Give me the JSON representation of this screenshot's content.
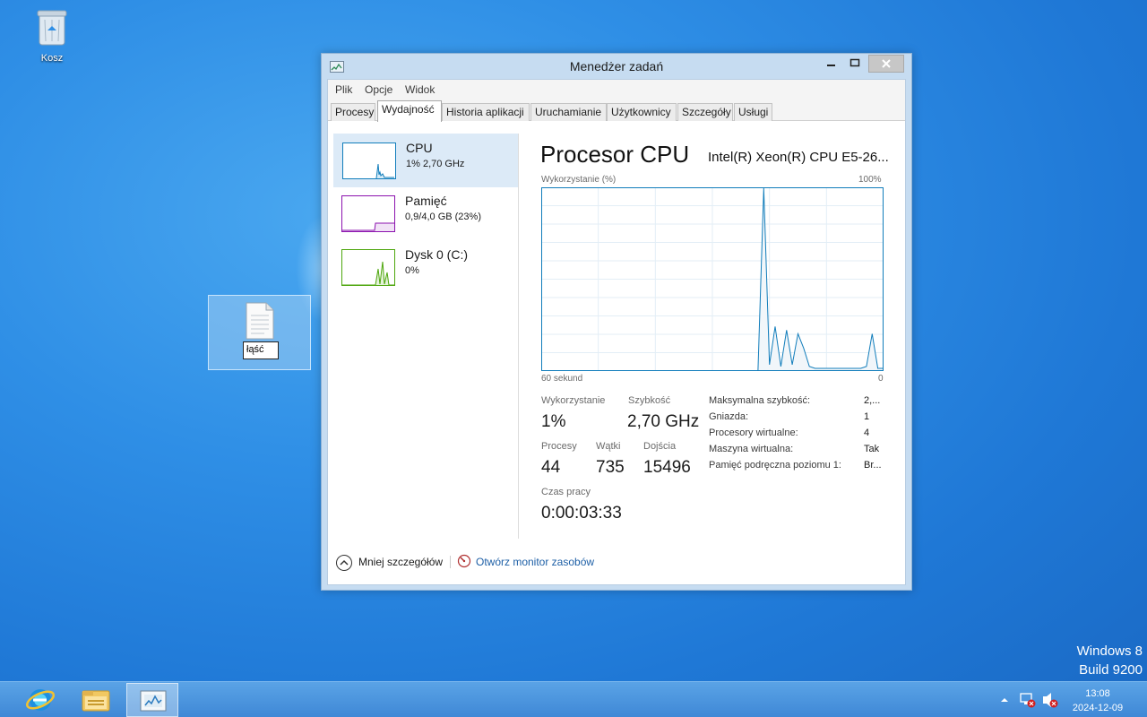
{
  "desktop": {
    "recycle_bin_label": "Kosz",
    "rename_value": "łąść"
  },
  "window": {
    "title": "Menedżer zadań",
    "menu": [
      "Plik",
      "Opcje",
      "Widok"
    ],
    "tabs": [
      "Procesy",
      "Wydajność",
      "Historia aplikacji",
      "Uruchamianie",
      "Użytkownicy",
      "Szczegóły",
      "Usługi"
    ],
    "active_tab": "Wydajność"
  },
  "perf_list": [
    {
      "name": "CPU",
      "detail": "1%  2,70 GHz",
      "color": "#117dbb"
    },
    {
      "name": "Pamięć",
      "detail": "0,9/4,0 GB (23%)",
      "color": "#8b12ae"
    },
    {
      "name": "Dysk 0 (C:)",
      "detail": "0%",
      "color": "#4da60c"
    }
  ],
  "cpu_panel": {
    "title": "Procesor CPU",
    "model": "Intel(R) Xeon(R) CPU E5-26...",
    "graph_label_left": "Wykorzystanie (%)",
    "graph_label_right": "100%",
    "x_label_left": "60 sekund",
    "x_label_right": "0",
    "utilization_label": "Wykorzystanie",
    "utilization_value": "1%",
    "speed_label": "Szybkość",
    "speed_value": "2,70 GHz",
    "processes_label": "Procesy",
    "processes_value": "44",
    "threads_label": "Wątki",
    "threads_value": "735",
    "handles_label": "Dojścia",
    "handles_value": "15496",
    "uptime_label": "Czas pracy",
    "uptime_value": "0:00:03:33",
    "specs": [
      {
        "label": "Maksymalna szybkość:",
        "value": "2,..."
      },
      {
        "label": "Gniazda:",
        "value": "1"
      },
      {
        "label": "Procesory wirtualne:",
        "value": "4"
      },
      {
        "label": "Maszyna wirtualna:",
        "value": "Tak"
      },
      {
        "label": "Pamięć podręczna poziomu 1:",
        "value": "Br..."
      }
    ]
  },
  "chart_data": {
    "type": "line",
    "ylabel": "Wykorzystanie (%)",
    "ylim": [
      0,
      100
    ],
    "xlim": [
      60,
      0
    ],
    "x": [
      60,
      59,
      58,
      57,
      56,
      55,
      54,
      53,
      52,
      51,
      50,
      49,
      48,
      47,
      46,
      45,
      44,
      43,
      42,
      41,
      40,
      39,
      38,
      37,
      36,
      35,
      34,
      33,
      32,
      31,
      30,
      29,
      28,
      27,
      26,
      25,
      24,
      23,
      22,
      21,
      20,
      19,
      18,
      17,
      16,
      15,
      14,
      13,
      12,
      11,
      10,
      9,
      8,
      7,
      6,
      5,
      4,
      3,
      2,
      1,
      0
    ],
    "series": [
      {
        "values": [
          null,
          null,
          null,
          null,
          null,
          null,
          null,
          null,
          null,
          null,
          null,
          null,
          null,
          null,
          null,
          null,
          null,
          null,
          null,
          null,
          null,
          null,
          null,
          null,
          null,
          null,
          null,
          null,
          null,
          null,
          null,
          null,
          null,
          null,
          null,
          null,
          null,
          null,
          0,
          100,
          3,
          24,
          2,
          22,
          3,
          20,
          12,
          2,
          1,
          1,
          1,
          1,
          1,
          1,
          1,
          1,
          1,
          2,
          20,
          1,
          1
        ]
      }
    ]
  },
  "footer": {
    "less_details": "Mniej szczegółów",
    "open_monitor": "Otwórz monitor zasobów"
  },
  "watermark": {
    "line1": "Windows 8",
    "line2": "Build 9200"
  },
  "taskbar": {
    "time": "13:08",
    "date": "2024-12-09"
  }
}
